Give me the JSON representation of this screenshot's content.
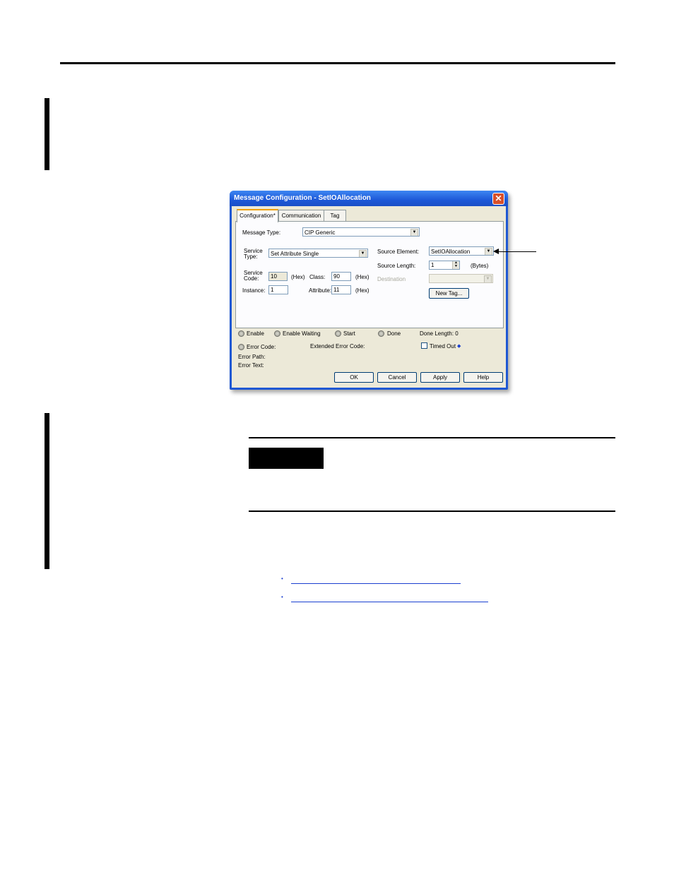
{
  "dialog": {
    "title": "Message Configuration - SetIOAllocation",
    "close_glyph": "✕",
    "tabs": [
      {
        "label": "Configuration*"
      },
      {
        "label": "Communication"
      },
      {
        "label": "Tag"
      }
    ],
    "message_type": {
      "label": "Message Type:",
      "value": "CIP Generic"
    },
    "service_type": {
      "label_line1": "Service",
      "label_line2": "Type:",
      "value": "Set Attribute Single"
    },
    "service_code": {
      "label_line1": "Service",
      "label_line2": "Code:",
      "value": "10",
      "unit": "(Hex)"
    },
    "class": {
      "label": "Class:",
      "value": "90",
      "unit": "(Hex)"
    },
    "instance": {
      "label": "Instance:",
      "value": "1"
    },
    "attribute": {
      "label": "Attribute:",
      "value": "11",
      "unit": "(Hex)"
    },
    "source_element": {
      "label": "Source Element:",
      "value": "SetIOAllocation"
    },
    "source_length": {
      "label": "Source Length:",
      "value": "1",
      "unit": "(Bytes)"
    },
    "destination": {
      "label": "Destination",
      "value": ""
    },
    "new_tag_button": "New Tag...",
    "status": {
      "enable": "Enable",
      "enable_waiting": "Enable Waiting",
      "start": "Start",
      "done": "Done",
      "done_length": "Done Length: 0",
      "error_code": "Error Code:",
      "extended_error_code": "Extended Error Code:",
      "timed_out": "Timed Out",
      "timed_out_glyph": "◆",
      "error_path": "Error Path:",
      "error_text": "Error Text:"
    },
    "buttons": {
      "ok": "OK",
      "cancel": "Cancel",
      "apply": "Apply",
      "help": "Help"
    }
  },
  "links": [
    {
      "bullet": "•",
      "text": "                                                              "
    },
    {
      "bullet": "•",
      "text": "                                                                    "
    }
  ],
  "colors": {
    "title_bar": "#1f58d3",
    "dialog_face": "#ece9d8",
    "link": "#1a3fd0",
    "tab_highlight": "#f0a000"
  }
}
